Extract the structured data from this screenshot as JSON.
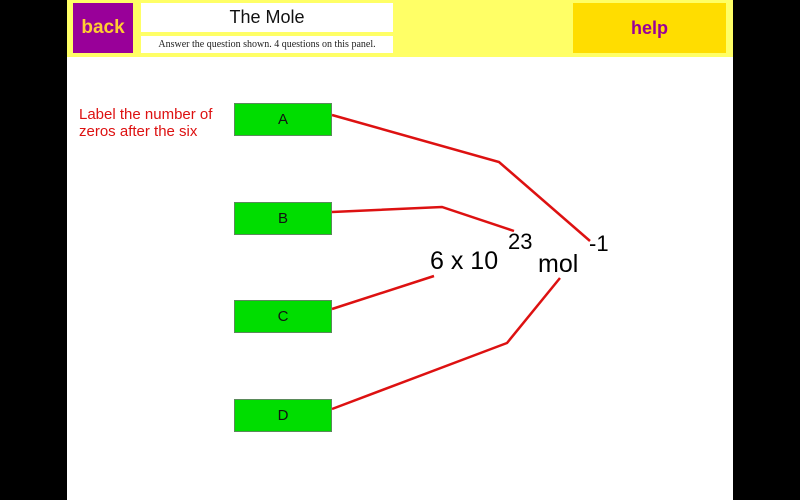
{
  "header": {
    "back_label": "back",
    "title": "The Mole",
    "subtitle": "Answer the question shown. 4 questions on this panel.",
    "help_label": "help"
  },
  "question": {
    "instruction": "Label the number of zeros after the six",
    "formula": {
      "coefficient": "6 x 10",
      "exponent": "23",
      "unit": "mol",
      "unit_exponent": "-1"
    }
  },
  "answer_boxes": [
    {
      "label": "A"
    },
    {
      "label": "B"
    },
    {
      "label": "C"
    },
    {
      "label": "D"
    }
  ],
  "colors": {
    "back_bg": "#990099",
    "back_text": "#ffcc33",
    "header_bg": "#ffff66",
    "help_bg": "#ffdd00",
    "help_text": "#990099",
    "box_bg": "#00dd00",
    "line_color": "#dd1111"
  }
}
